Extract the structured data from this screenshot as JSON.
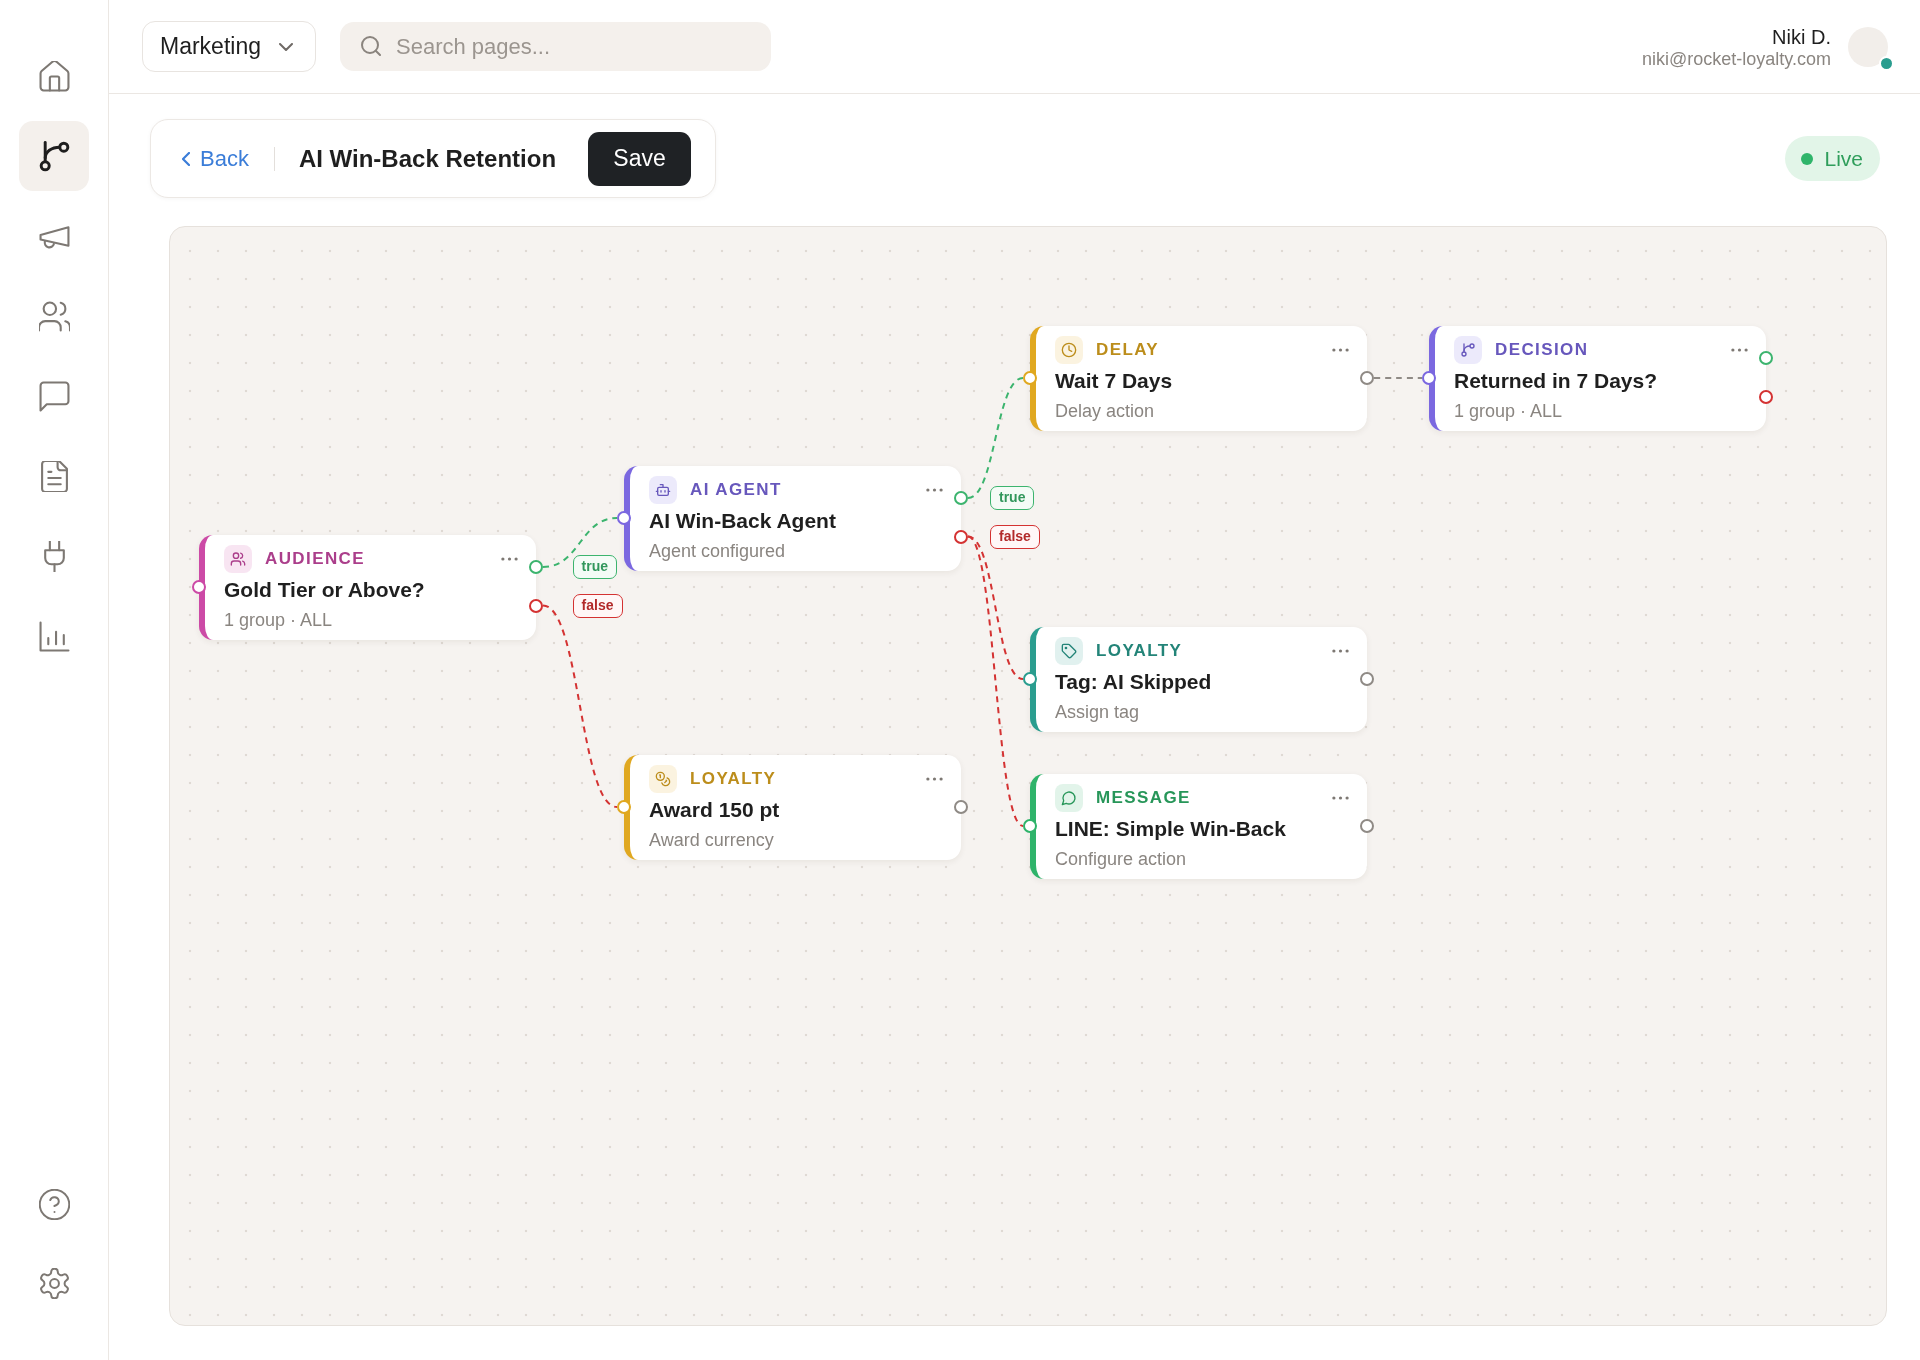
{
  "sidebar": {
    "items": [
      {
        "selected": false
      },
      {
        "selected": true
      },
      {
        "selected": false
      },
      {
        "selected": false
      },
      {
        "selected": false
      },
      {
        "selected": false
      },
      {
        "selected": false
      },
      {
        "selected": false
      }
    ],
    "footer_items": [
      {
        "selected": false
      },
      {
        "selected": false
      }
    ]
  },
  "top_bar": {
    "workspace": {
      "label": "Marketing"
    },
    "search": {
      "placeholder": "Search pages..."
    },
    "user": {
      "name": "Niki D.",
      "email": "niki@rocket-loyalty.com",
      "online": true
    }
  },
  "header": {
    "back": "Back",
    "title": "AI Win-Back Retention",
    "save": "Save",
    "status": {
      "label": "Live"
    }
  },
  "canvas": {
    "nodes": [
      {
        "kind": "audience",
        "category": "AUDIENCE",
        "title": "Gold Tier or Above?",
        "subtitle": "1 group · ALL",
        "color": "#cc4aa6",
        "children": [
          {
            "edge": {
              "kind": "true_branch",
              "label": "true"
            },
            "kind": "ai_agent",
            "category": "AI AGENT",
            "title": "AI Win-Back Agent",
            "subtitle": "Agent configured",
            "color": "#7b68e0",
            "children": [
              {
                "edge": {
                  "kind": "true_branch",
                  "label": "true"
                },
                "kind": "delay",
                "category": "DELAY",
                "title": "Wait 7 Days",
                "subtitle": "Delay action",
                "color": "#e0a820",
                "children": [
                  {
                    "edge": {
                      "kind": "next"
                    },
                    "kind": "decision",
                    "category": "DECISION",
                    "title": "Returned in 7 Days?",
                    "subtitle": "1 group · ALL",
                    "color": "#7b68e0"
                  }
                ]
              },
              {
                "edge": {
                  "kind": "false_branch",
                  "label": "false"
                },
                "kind": "tag",
                "category": "LOYALTY",
                "title": "Tag: AI Skipped",
                "subtitle": "Assign tag",
                "color": "#2a9d8f"
              },
              {
                "edge": {
                  "kind": "false_branch"
                },
                "kind": "message",
                "category": "MESSAGE",
                "title": "LINE: Simple Win-Back",
                "subtitle": "Configure action",
                "color": "#2fb36a"
              }
            ]
          },
          {
            "edge": {
              "kind": "false_branch",
              "label": "false"
            },
            "kind": "award",
            "category": "LOYALTY",
            "title": "Award 150 pt",
            "subtitle": "Award currency",
            "color": "#e0a820"
          }
        ]
      }
    ]
  }
}
